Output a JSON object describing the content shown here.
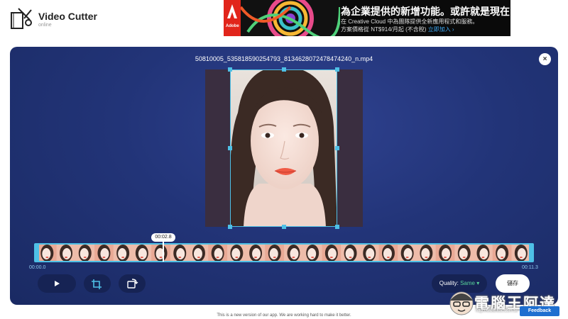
{
  "app": {
    "title": "Video Cutter",
    "subtitle": "online"
  },
  "ad": {
    "brand": "Adobe",
    "headline": "為企業提供的新增功能。或許就是現在！",
    "line1": "在 Creative Cloud 中為團隊提供全新應用程式和服務。",
    "line2": "方案價格從 NT$914/月起 (不含稅)",
    "link": "立即加入 ›"
  },
  "editor": {
    "filename": "50810005_535818590254793_8134628072478474240_n.mp4",
    "close_label": "×",
    "playhead_time": "00:02.8",
    "start_time": "00:00.0",
    "end_time": "00:11.3",
    "quality_label": "Quality:",
    "quality_value": "Same",
    "save_label": "儲存",
    "playhead_fraction": 0.247
  },
  "footer": {
    "note": "This is a new version of our app. We are working hard to make it better.",
    "feedback": "Feedback"
  },
  "watermark": {
    "text": "電腦王阿達",
    "url": "http://www.koc.com.tw"
  },
  "colors": {
    "accent": "#4ec0e6",
    "panel": "#223478",
    "quality": "#58d39a",
    "feedback": "#1e6fd0"
  }
}
